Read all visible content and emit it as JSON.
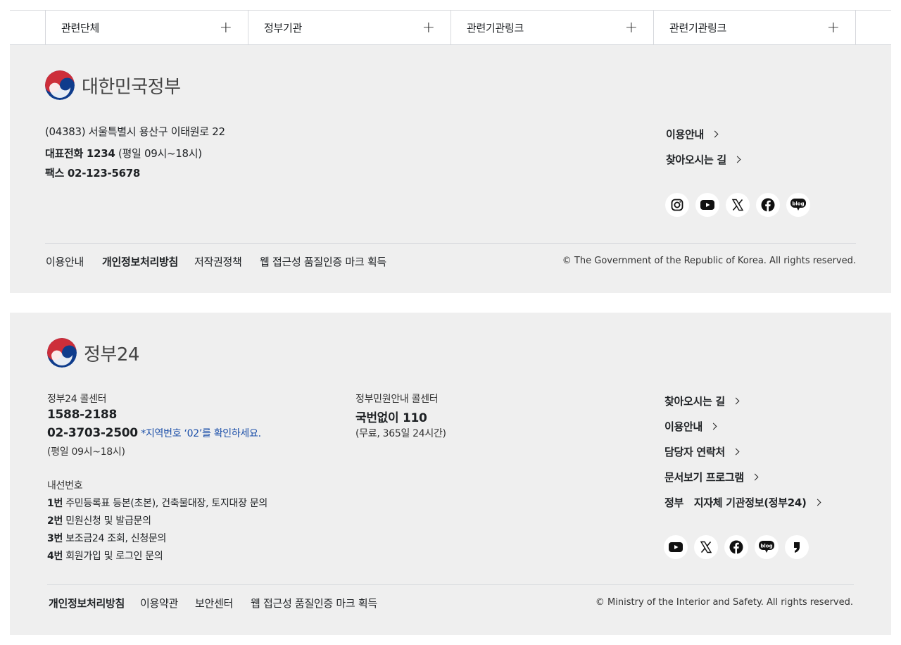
{
  "top_links": [
    {
      "label": "관련단체"
    },
    {
      "label": "정부기관"
    },
    {
      "label": "관련기관링크"
    },
    {
      "label": "관련기관링크"
    }
  ],
  "footer1": {
    "brand": "대한민국정부",
    "address": "(04383) 서울특별시 용산구 이태원로 22",
    "phone_label": "대표전화 1234",
    "phone_hours": "(평일 09시~18시)",
    "fax": "팩스 02-123-5678",
    "links": [
      "이용안내",
      "찾아오시는 길"
    ],
    "social": [
      "instagram-icon",
      "youtube-icon",
      "x-icon",
      "facebook-icon",
      "blog-icon"
    ],
    "bottom_links": [
      "이용안내",
      "개인정보처리방침",
      "저작권정책",
      "웹 접근성 품질인증 마크 획득"
    ],
    "copyright": "© The Government of the Republic of Korea. All rights reserved."
  },
  "footer2": {
    "brand": "정부24",
    "center1_title": "정부24 콜센터",
    "center1_num1": "1588-2188",
    "center1_num2": "02-3703-2500",
    "center1_note": "*지역번호 ‘02’를 확인하세요.",
    "center1_hours": "(평일 09시~18시)",
    "center2_title": "정부민원안내 콜센터",
    "center2_num": "국번없이 110",
    "center2_hours": "(무료, 365일 24시간)",
    "ext_title": "내선번호",
    "ext": [
      {
        "num": "1번",
        "desc": "주민등록표 등본(초본), 건축물대장, 토지대장 문의"
      },
      {
        "num": "2번",
        "desc": "민원신청 및 발급문의"
      },
      {
        "num": "3번",
        "desc": "보조금24 조회, 신청문의"
      },
      {
        "num": "4번",
        "desc": "회원가입 및 로그인 문의"
      }
    ],
    "links": [
      "찾아오시는 길",
      "이용안내",
      "담당자 연락처",
      "문서보기 프로그램",
      "정부   지자체 기관정보(정부24)"
    ],
    "social": [
      "youtube-icon",
      "x-icon",
      "facebook-icon",
      "blog-icon",
      "brunch-icon"
    ],
    "bottom_links": [
      "개인정보처리방침",
      "이용약관",
      "보안센터",
      "웹 접근성 품질인증 마크 획득"
    ],
    "copyright": "© Ministry of the Interior and Safety. All rights reserved."
  },
  "colors": {
    "panel_bg": "#efefef",
    "navy": "#0b2f6e",
    "taeguk_red": "#cd2e3a",
    "taeguk_blue": "#0f3c8c"
  }
}
